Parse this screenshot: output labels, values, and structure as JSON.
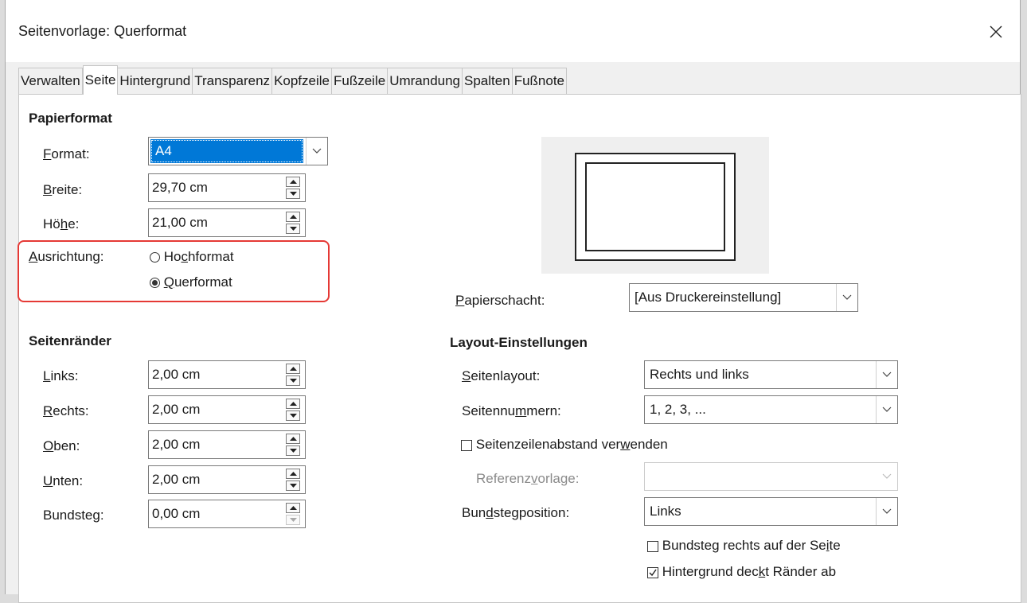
{
  "window": {
    "title": "Seitenvorlage: Querformat"
  },
  "tabs": [
    {
      "label": "Verwalten"
    },
    {
      "label": "Seite",
      "active": true
    },
    {
      "label": "Hintergrund"
    },
    {
      "label": "Transparenz"
    },
    {
      "label": "Kopfzeile"
    },
    {
      "label": "Fußzeile"
    },
    {
      "label": "Umrandung"
    },
    {
      "label": "Spalten"
    },
    {
      "label": "Fußnote"
    }
  ],
  "paper_format": {
    "heading": "Papierformat",
    "format": {
      "label_pre": "",
      "label_accel": "F",
      "label_post": "ormat:",
      "value": "A4"
    },
    "width": {
      "label_pre": "",
      "label_accel": "B",
      "label_post": "reite:",
      "value": "29,70 cm"
    },
    "height": {
      "label_pre": "Hö",
      "label_accel": "h",
      "label_post": "e:",
      "value": "21,00 cm"
    },
    "orientation": {
      "label_pre": "",
      "label_accel": "A",
      "label_post": "usrichtung:",
      "portrait": {
        "label_pre": "Ho",
        "label_accel": "c",
        "label_post": "hformat",
        "selected": false
      },
      "landscape": {
        "label_pre": "",
        "label_accel": "Q",
        "label_post": "uerformat",
        "selected": true
      }
    },
    "paper_tray": {
      "label_pre": "",
      "label_accel": "P",
      "label_post": "apierschacht:",
      "value": "[Aus Druckereinstellung]"
    }
  },
  "margins": {
    "heading": "Seitenränder",
    "left": {
      "label_pre": "",
      "label_accel": "L",
      "label_post": "inks:",
      "value": "2,00 cm"
    },
    "right": {
      "label_pre": "",
      "label_accel": "R",
      "label_post": "echts:",
      "value": "2,00 cm"
    },
    "top": {
      "label_pre": "",
      "label_accel": "O",
      "label_post": "ben:",
      "value": "2,00 cm"
    },
    "bottom": {
      "label_pre": "",
      "label_accel": "U",
      "label_post": "nten:",
      "value": "2,00 cm"
    },
    "gutter": {
      "label_pre": "Bundste",
      "label_accel": "g",
      "label_post": ":",
      "value": "0,00 cm"
    }
  },
  "layout": {
    "heading": "Layout-Einstellungen",
    "page_layout": {
      "label_pre": "",
      "label_accel": "S",
      "label_post": "eitenlayout:",
      "value": "Rechts und links"
    },
    "page_numbers": {
      "label_pre": "Seitennu",
      "label_accel": "m",
      "label_post": "mern:",
      "value": "1, 2, 3, ..."
    },
    "register_true": {
      "label_pre": "Seitenzeilenabstand ver",
      "label_accel": "w",
      "label_post": "enden",
      "checked": false
    },
    "reference_style": {
      "label_pre": "Referenz",
      "label_accel": "v",
      "label_post": "orlage:",
      "value": ""
    },
    "gutter_position": {
      "label_pre": "Bun",
      "label_accel": "d",
      "label_post": "stegposition:",
      "value": "Links"
    },
    "gutter_right": {
      "label_pre": "Bundsteg rechts auf der Se",
      "label_accel": "i",
      "label_post": "te",
      "checked": false
    },
    "background_covers": {
      "label_pre": "Hintergrund dec",
      "label_accel": "k",
      "label_post": "t Ränder ab",
      "checked": true
    }
  },
  "colors": {
    "accent": "#0078d7",
    "highlight": "#e53935",
    "disabled_text": "#8a8a8a"
  }
}
